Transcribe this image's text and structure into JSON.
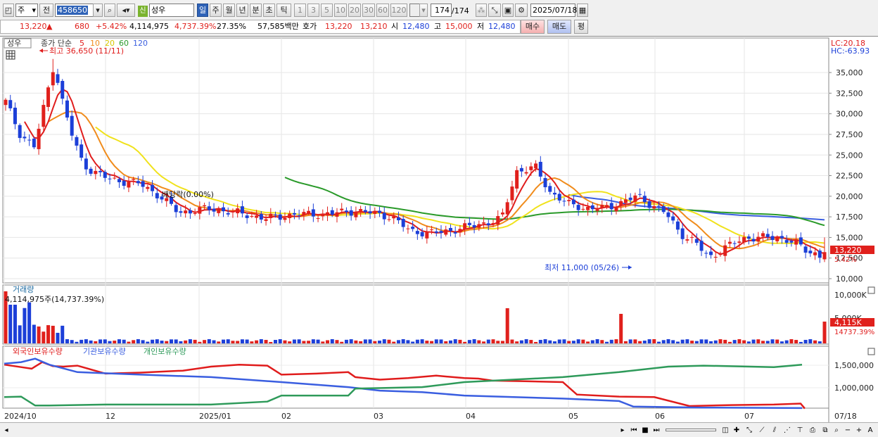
{
  "toolbar": {
    "market": "주",
    "prev_label": "전",
    "code": "458650",
    "credit_badge": "신",
    "name": "성우",
    "periods": [
      "일",
      "주",
      "월",
      "년",
      "분",
      "초",
      "틱"
    ],
    "active_period": "일",
    "intervals": [
      "1",
      "3",
      "5",
      "10",
      "20",
      "30",
      "60",
      "120"
    ],
    "count": "174",
    "count_total": "/174",
    "date": "2025/07/18"
  },
  "quote": {
    "price": "13,220",
    "change_arrow": "▲",
    "change": "680",
    "change_pct": "+5.42%",
    "volume": "4,114,975",
    "volume_ratio": "4,737.39%",
    "turnover": "27.35%",
    "amount": "57,585백만",
    "ask_label": "호가",
    "ask": "13,220",
    "bid": "13,210",
    "open_label": "시",
    "open": "12,480",
    "high_label": "고",
    "high": "15,000",
    "low_label": "저",
    "low": "12,480",
    "buy_button": "매수",
    "sell_button": "매도",
    "eval_button": "평"
  },
  "price_pane": {
    "legend_name": "성우",
    "legend_label": "종가 단순",
    "ma_periods": [
      "5",
      "10",
      "20",
      "60",
      "120"
    ],
    "high_note": "최고 36,650 (11/11)",
    "low_note": "최저 11,000 (05/26)",
    "dividend_note": "배당락(0.00%)",
    "lc": "LC:20.18",
    "hc": "HC:-63.93",
    "y_ticks": [
      "35,000",
      "32,500",
      "30,000",
      "27,500",
      "25,000",
      "22,500",
      "20,000",
      "17,500",
      "15,000",
      "12,500",
      "10,000"
    ],
    "current_price_tag": "13,220",
    "current_pct_tag": "5.42%"
  },
  "volume_pane": {
    "title": "거래량",
    "value_label": "4,114,975주(14,737.39%)",
    "y_ticks": [
      "10,000K",
      "5,000K"
    ],
    "current_tag": "4,115K",
    "current_pct_tag": "14737.39%"
  },
  "holdings_pane": {
    "series_names": [
      "외국인보유수량",
      "기관보유수량",
      "개인보유수량"
    ],
    "y_ticks": [
      "1,500,000",
      "1,000,000"
    ]
  },
  "x_axis": {
    "labels": [
      "2024/10",
      "12",
      "2025/01",
      "02",
      "03",
      "04",
      "05",
      "06",
      "07"
    ],
    "right_label": "07/18"
  },
  "colors": {
    "up": "#e0201c",
    "down": "#1c3fd8",
    "ma5": "#e01c1c",
    "ma10": "#f08c1c",
    "ma20": "#f0e21c",
    "ma60": "#2a9a2a",
    "ma120": "#3a5ee0",
    "foreign": "#e01c1c",
    "institution": "#3a5ee0",
    "individual": "#2e9a5a"
  },
  "chart_data": {
    "type": "line",
    "title": "",
    "price_range": [
      10000,
      37000
    ],
    "anchors_dates": [
      "2024/10",
      "12",
      "2025/01",
      "02",
      "03",
      "04",
      "05",
      "06",
      "07",
      "07/18"
    ],
    "close_approx": [
      31000,
      27000,
      22000,
      18500,
      16500,
      15500,
      22000,
      18000,
      13500,
      14500,
      15000,
      12000,
      12500,
      13500,
      13000,
      13220
    ],
    "series": [
      {
        "name": "5",
        "values": []
      },
      {
        "name": "10",
        "values": []
      },
      {
        "name": "20",
        "values": []
      },
      {
        "name": "60",
        "values": []
      },
      {
        "name": "120",
        "values": []
      }
    ]
  }
}
